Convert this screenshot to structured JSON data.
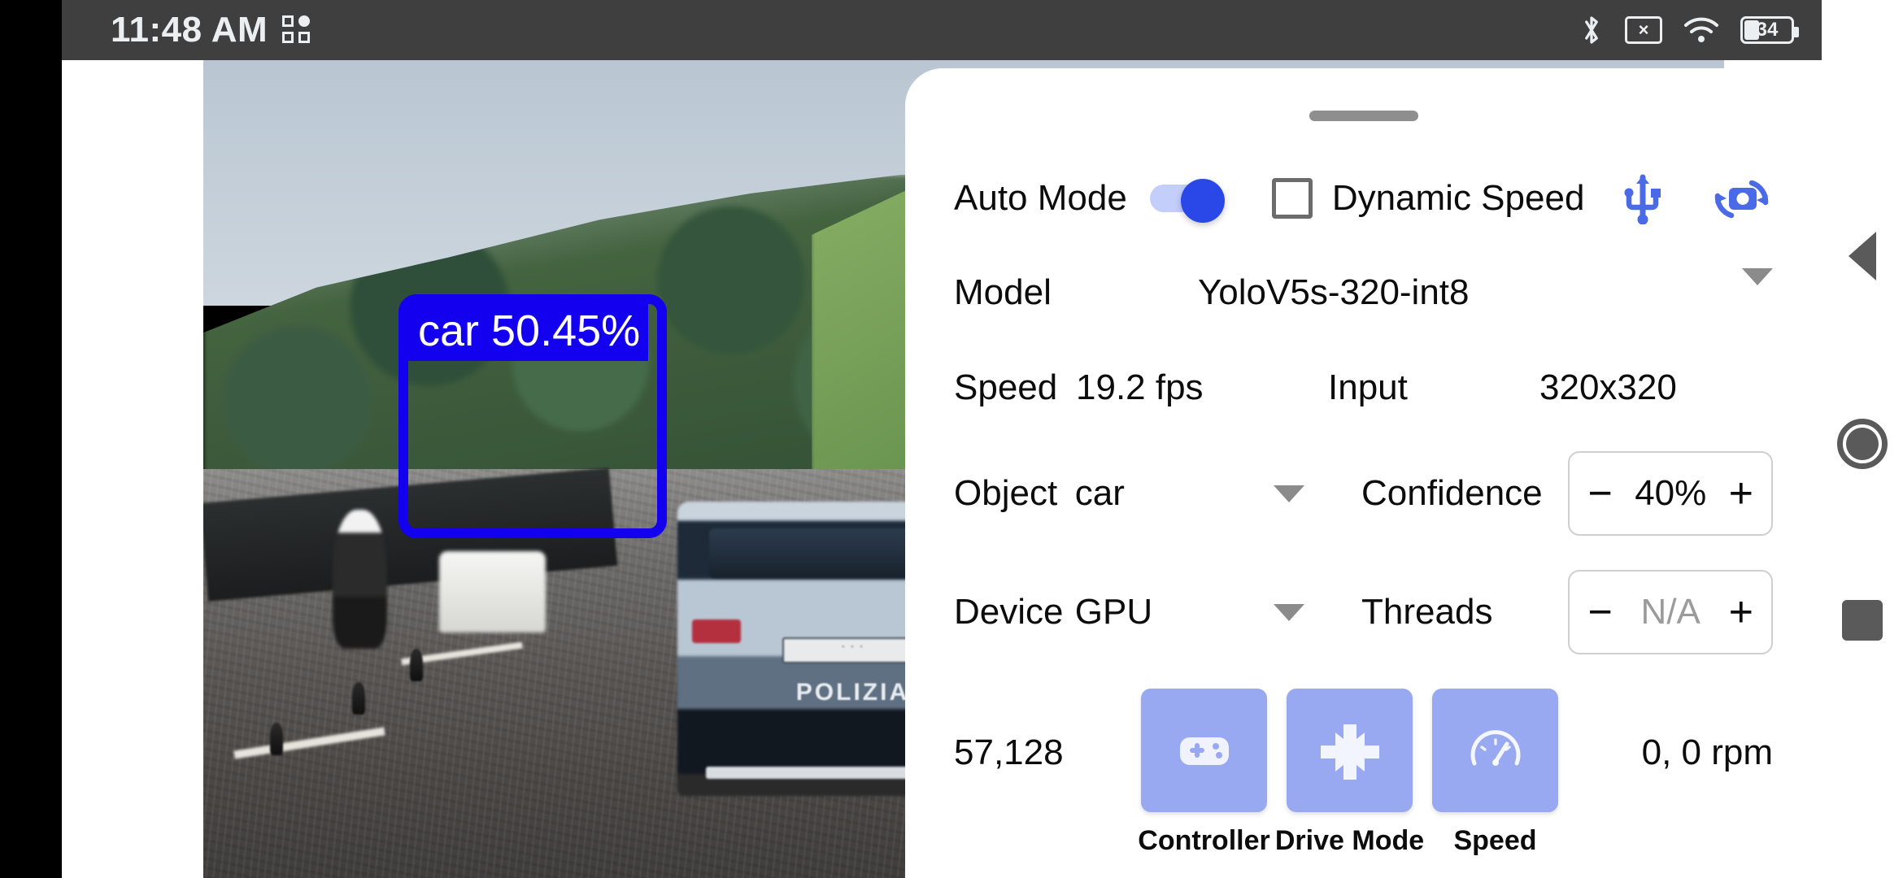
{
  "status_bar": {
    "clock": "11:48 AM",
    "apps_icon": "apps-grid-icon",
    "bluetooth_icon": "bluetooth-icon",
    "sim_icon": "no-sim-icon",
    "sim_glyph": "×",
    "wifi_icon": "wifi-icon",
    "battery_icon": "battery-icon",
    "battery_level": "34"
  },
  "camera": {
    "detection": {
      "label": "car 50.45%",
      "object_class": "car",
      "confidence": "50.45%",
      "box_color": "#1200ee"
    },
    "scene_text": {
      "vehicle_marking": "POLIZIA",
      "plate": "· · ·"
    }
  },
  "panel": {
    "drag_handle": "drag-handle",
    "auto_mode": {
      "label": "Auto Mode",
      "toggle_on": true,
      "toggle_color": "#2a47e8",
      "track_color": "#c3cefb"
    },
    "dynamic_speed": {
      "label": "Dynamic Speed",
      "checked": false
    },
    "usb_icon": "usb-icon",
    "camera_switch_icon": "camera-switch-icon",
    "icon_color": "#4a6ae8",
    "model": {
      "label": "Model",
      "value": "YoloV5s-320-int8",
      "caret": "chevron-down-icon"
    },
    "speed": {
      "label": "Speed",
      "value": "19.2 fps"
    },
    "input": {
      "label": "Input",
      "value": "320x320"
    },
    "object": {
      "label": "Object",
      "value": "car",
      "caret": "chevron-down-icon"
    },
    "confidence": {
      "label": "Confidence",
      "minus": "−",
      "value": "40%",
      "plus": "+"
    },
    "device": {
      "label": "Device",
      "value": "GPU",
      "caret": "chevron-down-icon"
    },
    "threads": {
      "label": "Threads",
      "minus": "−",
      "value": "N/A",
      "plus": "+"
    },
    "telemetry_left": "57,128",
    "telemetry_right": "0,  0 rpm",
    "actions": [
      {
        "label": "Controller",
        "icon": "gamepad-icon"
      },
      {
        "label": "Drive Mode",
        "icon": "dpad-icon"
      },
      {
        "label": "Speed",
        "icon": "speedometer-icon"
      }
    ],
    "tile_color": "#98a9f2"
  },
  "nav_bar": {
    "back": "back-triangle-icon",
    "home": "home-circle-icon",
    "recents": "recents-square-icon"
  }
}
